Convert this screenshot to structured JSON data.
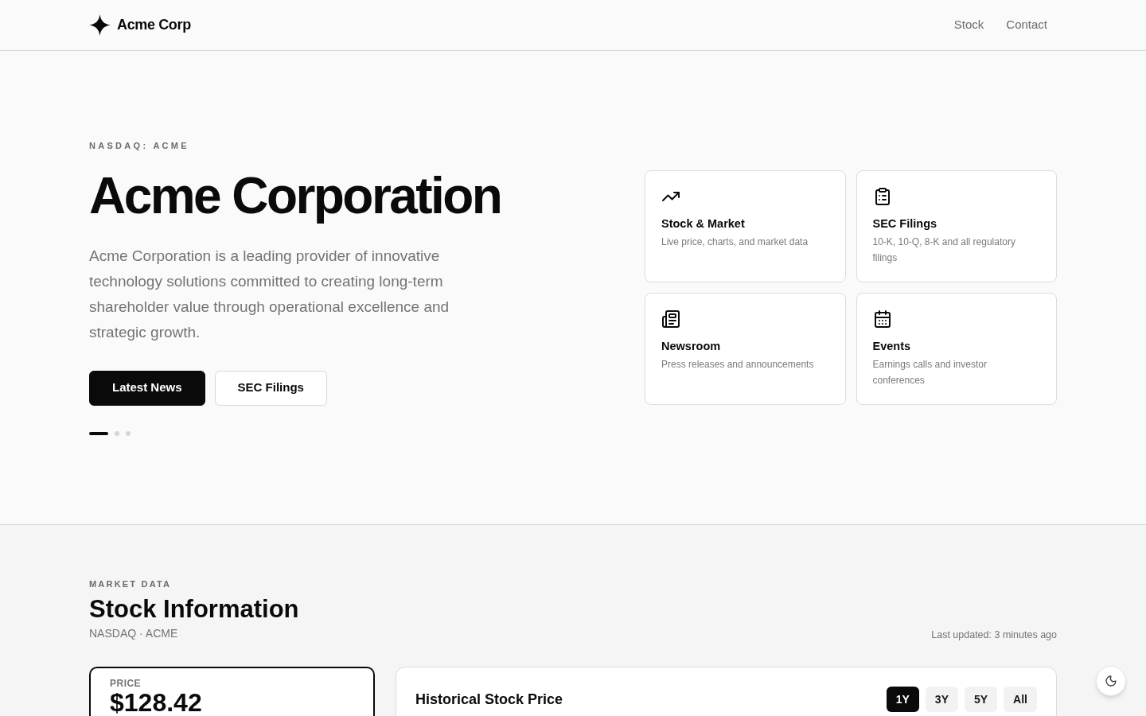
{
  "header": {
    "brand": "Acme Corp",
    "nav": [
      {
        "label": "Stock"
      },
      {
        "label": "Contact"
      }
    ]
  },
  "hero": {
    "eyebrow": "NASDAQ: ACME",
    "title": "Acme Corporation",
    "description": "Acme Corporation is a leading provider of innovative technology solutions committed to creating long-term shareholder value through operational excellence and strategic growth.",
    "buttons": [
      {
        "label": "Latest News",
        "kind": "primary"
      },
      {
        "label": "SEC Filings",
        "kind": "secondary"
      }
    ],
    "slides": [
      {
        "selected": true
      },
      {
        "selected": false
      },
      {
        "selected": false
      }
    ],
    "cards": [
      {
        "title": "Stock & Market",
        "description": "Live price, charts, and market data"
      },
      {
        "title": "SEC Filings",
        "description": "10-K, 10-Q, 8-K and all regulatory filings"
      },
      {
        "title": "Newsroom",
        "description": "Press releases and announcements"
      },
      {
        "title": "Events",
        "description": "Earnings calls and investor conferences"
      }
    ]
  },
  "stock_section": {
    "eyebrow": "MARKET DATA",
    "title": "Stock Information",
    "subtitle": "NASDAQ · ACME",
    "last_updated": "Last updated: 3 minutes ago",
    "price_card": {
      "label": "PRICE",
      "value": "$128.42"
    },
    "chart_card": {
      "title": "Historical Stock Price",
      "ranges": [
        {
          "label": "1Y",
          "selected": true
        },
        {
          "label": "3Y",
          "selected": false
        },
        {
          "label": "5Y",
          "selected": false
        },
        {
          "label": "All",
          "selected": false
        }
      ]
    }
  }
}
